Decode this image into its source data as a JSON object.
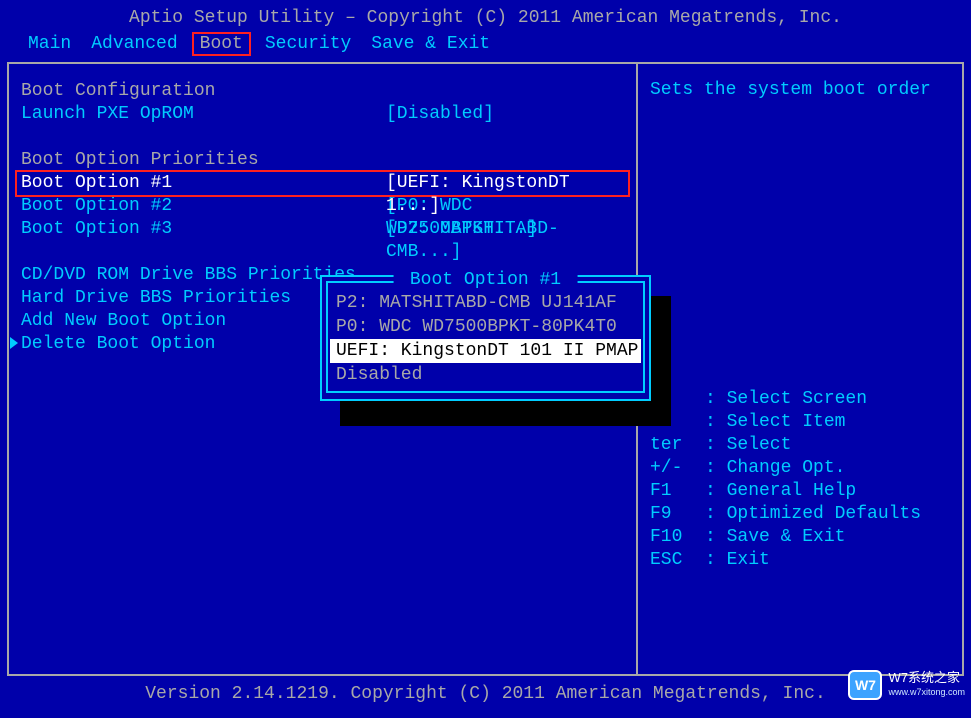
{
  "header": "Aptio Setup Utility – Copyright (C) 2011 American Megatrends, Inc.",
  "menu": {
    "items": [
      "Main",
      "Advanced",
      "Boot",
      "Security",
      "Save & Exit"
    ],
    "active_index": 2
  },
  "left": {
    "section_config": "Boot Configuration",
    "pxe": {
      "label": "Launch PXE OpROM",
      "value": "[Disabled]"
    },
    "section_priorities": "Boot Option Priorities",
    "options": [
      {
        "label": "Boot Option #1",
        "value": "[UEFI: KingstonDT 1...]"
      },
      {
        "label": "Boot Option #2",
        "value": "[P0: WDC WD7500BPKT...]"
      },
      {
        "label": "Boot Option #3",
        "value": "[P2: MATSHITABD-CMB...]"
      }
    ],
    "extra": [
      "CD/DVD ROM Drive BBS Priorities",
      "Hard Drive BBS Priorities",
      "Add New Boot Option",
      "Delete Boot Option"
    ]
  },
  "popup": {
    "title": "Boot Option #1",
    "items": [
      "P2: MATSHITABD-CMB UJ141AF",
      "P0: WDC WD7500BPKT-80PK4T0",
      "UEFI: KingstonDT 101 II PMAP",
      "Disabled"
    ],
    "selected_index": 2
  },
  "right": {
    "help": "Sets the system boot order",
    "keys": [
      {
        "k": "",
        "d": ": Select Screen"
      },
      {
        "k": "",
        "d": ": Select Item"
      },
      {
        "k": "ter",
        "d": ": Select"
      },
      {
        "k": "+/-",
        "d": ": Change Opt."
      },
      {
        "k": "F1",
        "d": ": General Help"
      },
      {
        "k": "F9",
        "d": ": Optimized Defaults"
      },
      {
        "k": "F10",
        "d": ": Save & Exit"
      },
      {
        "k": "ESC",
        "d": ": Exit"
      }
    ]
  },
  "footer": "Version 2.14.1219. Copyright (C) 2011 American Megatrends, Inc.",
  "watermark": {
    "badge": "W7",
    "title": "W7系统之家",
    "url": "www.w7xitong.com"
  }
}
